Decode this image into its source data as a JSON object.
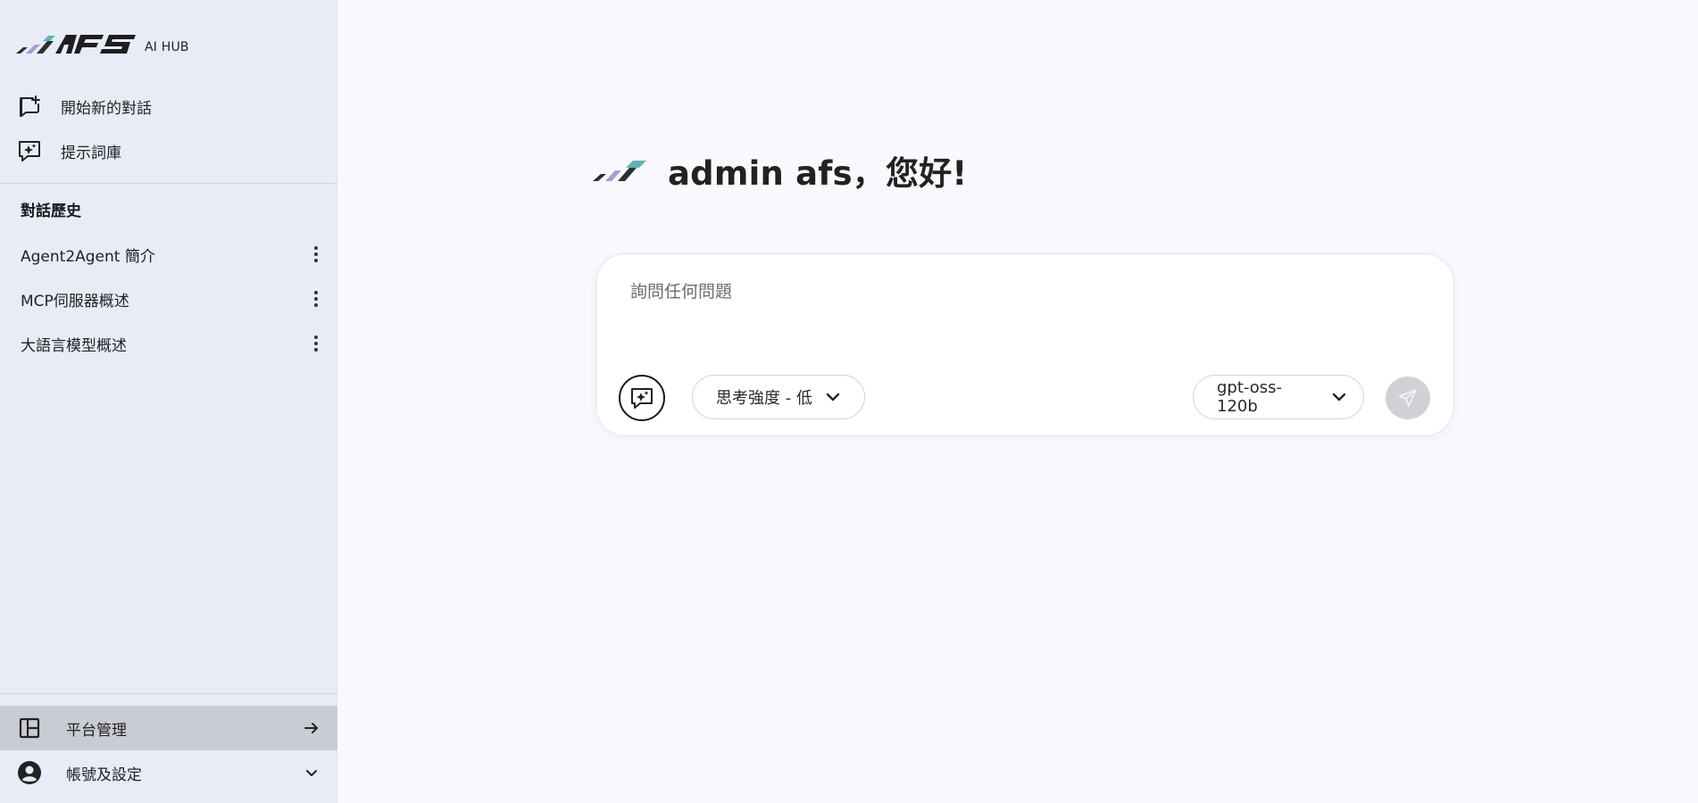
{
  "sidebar": {
    "logo": {
      "subtitle": "AI HUB",
      "brand_name": "AFS",
      "colors": [
        "#3b3b3b",
        "#a99bd1",
        "#5fb4b8"
      ]
    },
    "actions": [
      {
        "label": "開始新的對話",
        "icon": "new-chat-icon"
      },
      {
        "label": "提示詞庫",
        "icon": "prompt-library-icon"
      }
    ],
    "history_title": "對話歷史",
    "history": [
      {
        "label": "Agent2Agent 簡介"
      },
      {
        "label": "MCP伺服器概述"
      },
      {
        "label": "大語言模型概述"
      }
    ],
    "bottom": [
      {
        "label": "平台管理",
        "icon": "dashboard-layout-icon",
        "tail": "arrow-right-icon",
        "active": true
      },
      {
        "label": "帳號及設定",
        "icon": "user-account-icon",
        "tail": "chevron-down-icon",
        "active": false
      }
    ]
  },
  "main": {
    "greeting": "admin afs，您好!",
    "composer": {
      "placeholder": "詢問任何問題",
      "value": "",
      "reasoning_effort": "思考強度 - 低",
      "model": "gpt-oss-120b",
      "send_enabled": false
    }
  },
  "colors": {
    "sidebar_bg": "#e7ecf7",
    "main_bg": "#f7f9fd",
    "active_item_bg": "#c9ccd2",
    "send_disabled": "#cfd1d6"
  }
}
